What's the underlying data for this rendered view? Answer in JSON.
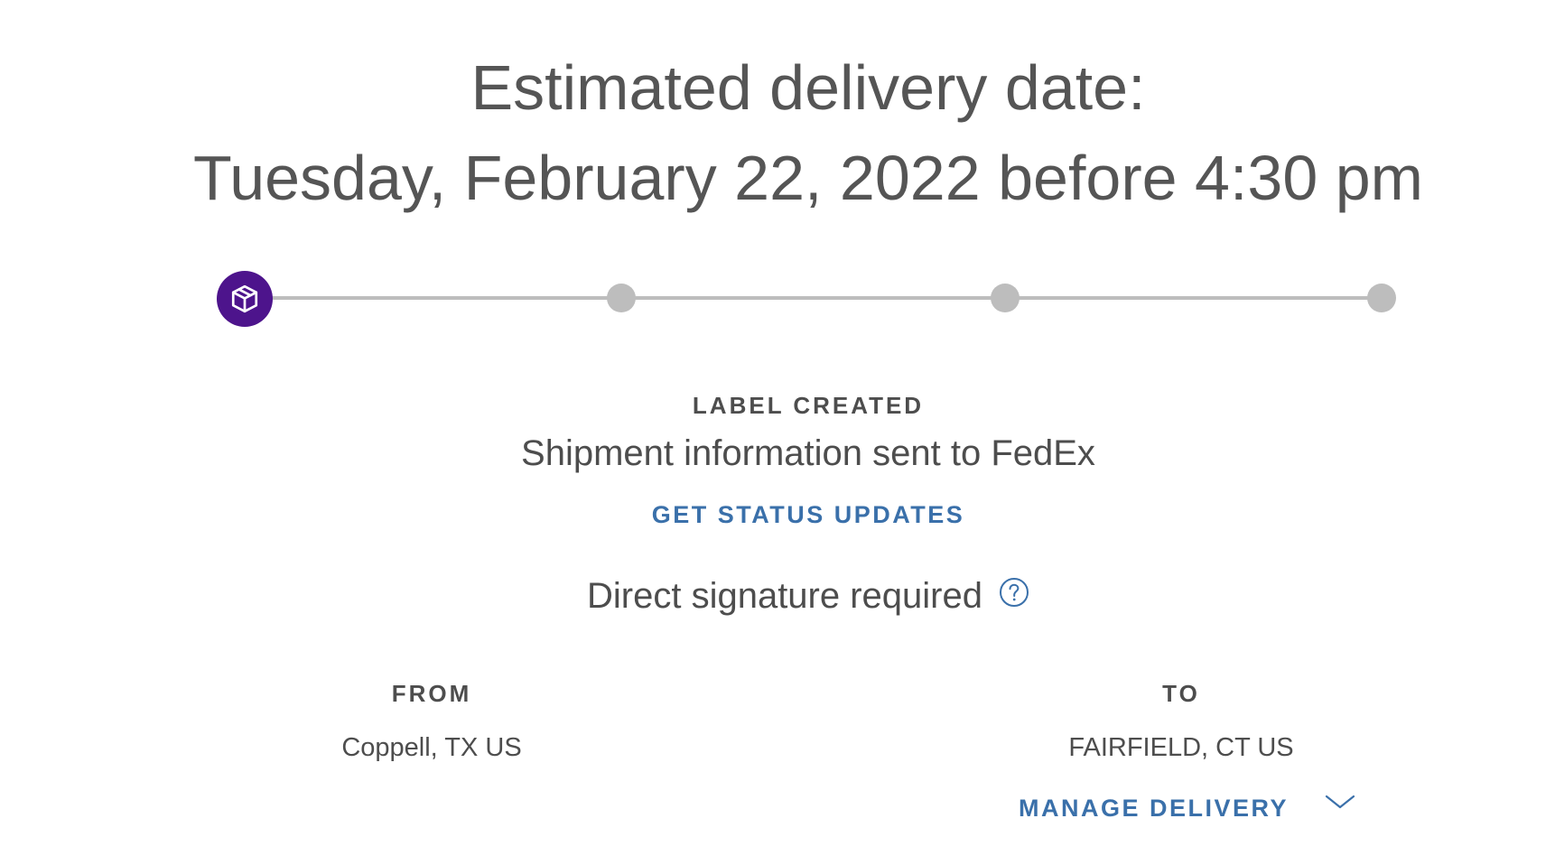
{
  "delivery": {
    "headline_line1": "Estimated delivery date:",
    "headline_line2": "Tuesday, February 22, 2022 before 4:30 pm"
  },
  "tracker": {
    "steps_total": 4,
    "current_step": 1,
    "current_step_icon": "package-box-icon",
    "active_color": "#4d148c",
    "inactive_color": "#bdbdbd"
  },
  "status": {
    "label": "LABEL CREATED",
    "description": "Shipment information sent to FedEx",
    "updates_link": "GET STATUS UPDATES"
  },
  "signature": {
    "text": "Direct signature required",
    "help_icon": "question-circle-icon"
  },
  "route": {
    "from_title": "FROM",
    "from_value": "Coppell, TX US",
    "to_title": "TO",
    "to_value": "FAIRFIELD, CT US"
  },
  "actions": {
    "manage_delivery_label": "MANAGE DELIVERY",
    "manage_delivery_icon": "chevron-down-icon"
  },
  "colors": {
    "link": "#3a70aa",
    "text": "#4d4d4d",
    "brand_purple": "#4d148c"
  }
}
